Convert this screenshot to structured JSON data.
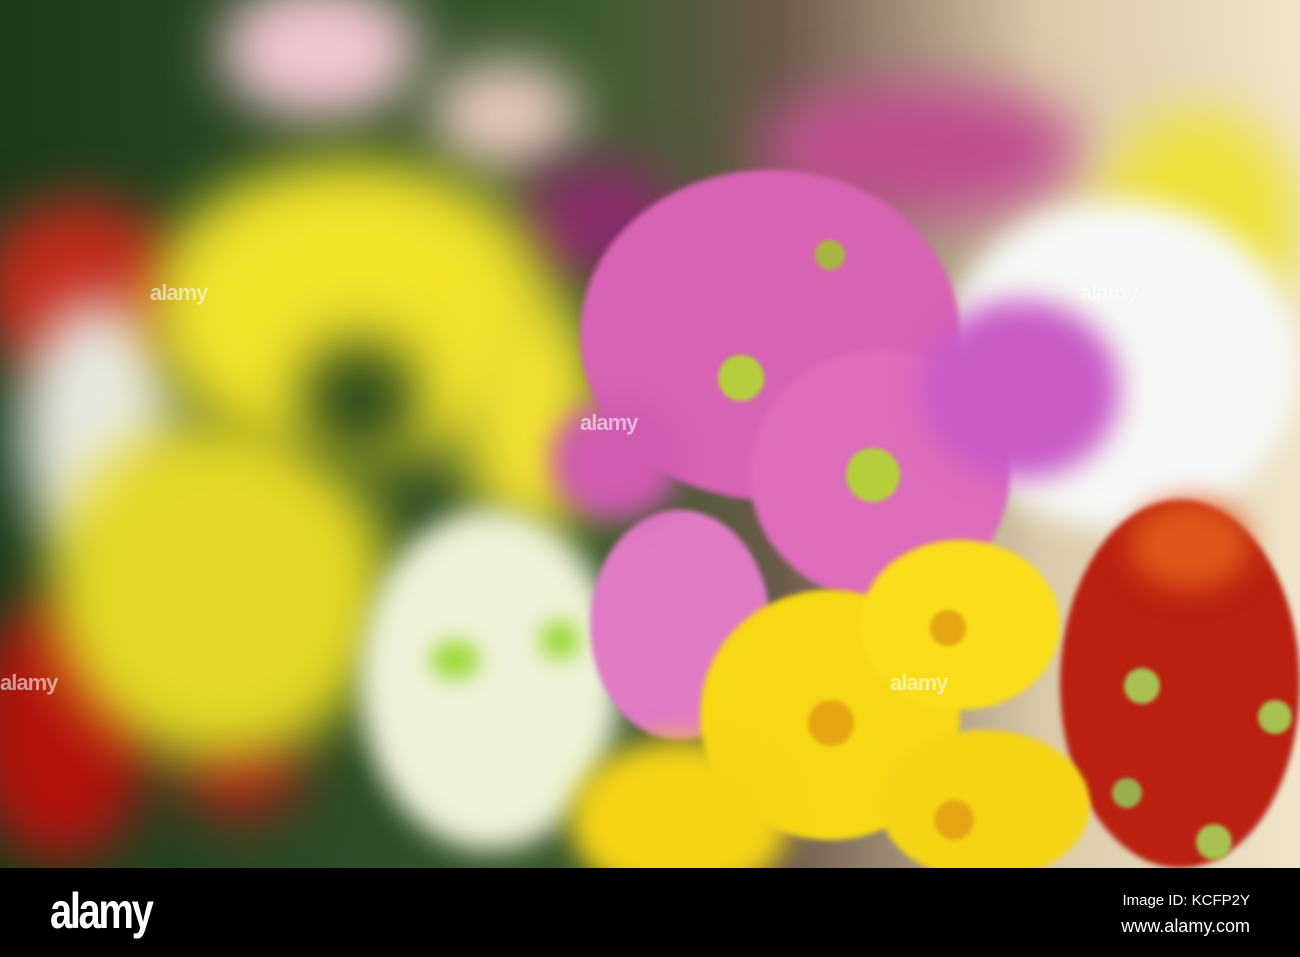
{
  "photo": {
    "subject": "Bouquet of chrysanthemums",
    "watermark": "alamy"
  },
  "footer": {
    "logo": "alamy",
    "image_id": "Image ID: KCFP2Y",
    "url": "www.alamy.com"
  },
  "colors": {
    "pink": "#d45fb0",
    "yellow": "#f5dc1a",
    "red": "#b8200e",
    "white": "#f4f4ee",
    "flower_center": "#b5cf3c"
  }
}
